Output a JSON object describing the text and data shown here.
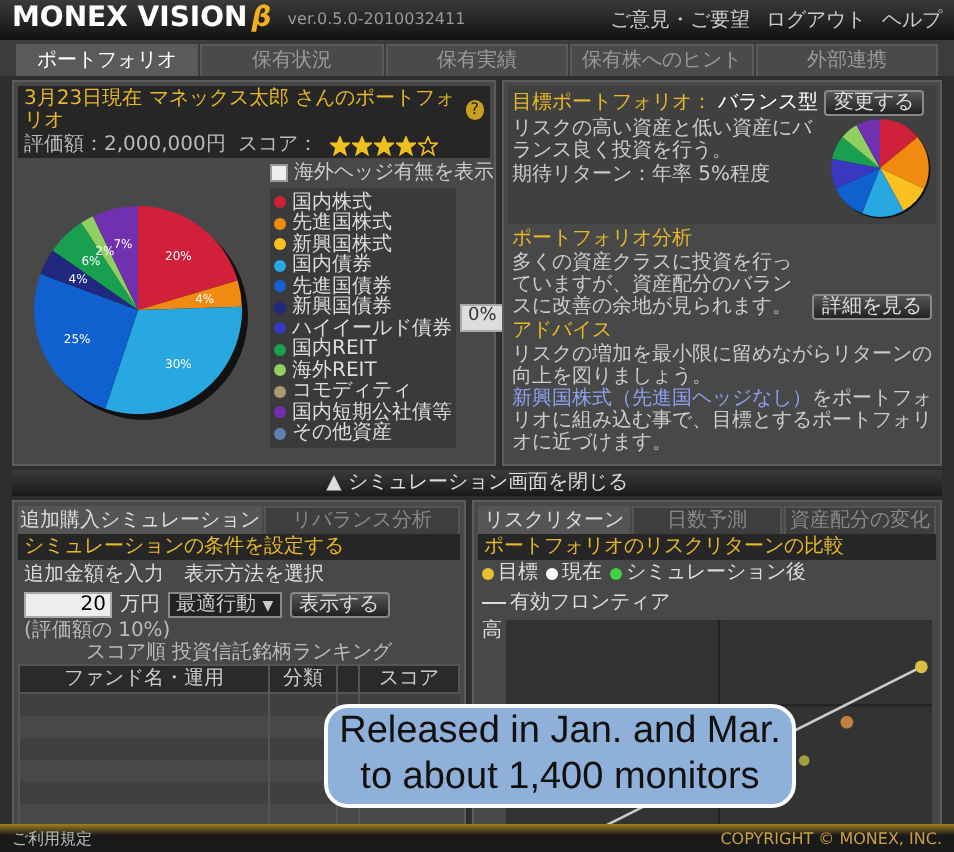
{
  "header": {
    "logo": "MONEX VISION",
    "logo_mark": "β",
    "version": "ver.0.5.0-2010032411",
    "links": [
      "ご意見・ご要望",
      "ログアウト",
      "ヘルプ"
    ]
  },
  "tabs": [
    {
      "label": "ポートフォリオ",
      "selected": true
    },
    {
      "label": "保有状況",
      "selected": false
    },
    {
      "label": "保有実績",
      "selected": false
    },
    {
      "label": "保有株へのヒント",
      "selected": false
    },
    {
      "label": "外部連携",
      "selected": false
    }
  ],
  "portfolio": {
    "title": "3月23日現在 マネックス太郎 さんのポートフォリオ",
    "value_label": "評価額：",
    "value": "2,000,000円",
    "score_label": "スコア：",
    "stars": 4,
    "hedge_checkbox": {
      "label": "海外ヘッジ有無を表示",
      "checked": false
    },
    "help_icon": "?",
    "chart_data": {
      "type": "pie",
      "values": [
        20,
        4,
        30,
        25,
        4,
        6,
        2,
        7
      ],
      "colors": [
        "#d0203a",
        "#f08a10",
        "#28a8e0",
        "#1060d0",
        "#202880",
        "#18a050",
        "#90d060",
        "#7030b0"
      ],
      "value_labels": [
        "20%",
        "4%",
        "30%",
        "25%",
        "4%",
        "6%",
        "2%",
        "7%"
      ]
    },
    "legend": [
      {
        "name": "国内株式",
        "color": "#d0203a"
      },
      {
        "name": "先進国株式",
        "color": "#f08a10"
      },
      {
        "name": "新興国株式",
        "color": "#f8c020"
      },
      {
        "name": "国内債券",
        "color": "#28a8e0"
      },
      {
        "name": "先進国債券",
        "color": "#1060d0"
      },
      {
        "name": "新興国債券",
        "color": "#202880"
      },
      {
        "name": "ハイイールド債券",
        "color": "#3838c0"
      },
      {
        "name": "国内REIT",
        "color": "#18a050"
      },
      {
        "name": "海外REIT",
        "color": "#90d060"
      },
      {
        "name": "コモディティ",
        "color": "#b09870"
      },
      {
        "name": "国内短期公社債等",
        "color": "#7030b0"
      },
      {
        "name": "その他資産",
        "color": "#6080b0"
      }
    ],
    "legend_button": "0%"
  },
  "target": {
    "title": "目標ポートフォリオ：",
    "type": "バランス型",
    "change_button": "変更する",
    "description": "リスクの高い資産と低い資産にバランス良く投資を行う。",
    "expected_return": "期待リターン：年率 5%程度"
  },
  "analysis": {
    "title": "ポートフォリオ分析",
    "text": "多くの資産クラスに投資を行っていますが、資産配分のバランスに改善の余地が見られます。",
    "detail_button": "詳細を見る"
  },
  "advice": {
    "title": "アドバイス",
    "text": "リスクの増加を最小限に留めながらリターンの向上を図りましょう。",
    "link": "新興国株式（先進国ヘッジなし）",
    "text_after": "をポートフォリオに組み込む事で、目標とするポートフォリオに近づけます。"
  },
  "close_bar": "▲ シミュレーション画面を閉じる",
  "simulation": {
    "tabs": [
      {
        "label": "追加購入シミュレーション",
        "selected": true
      },
      {
        "label": "リバランス分析",
        "selected": false
      }
    ],
    "title": "シミュレーションの条件を設定する",
    "steps": [
      "追加金額を入力",
      "表示方法を選択"
    ],
    "amount": "20",
    "unit": "万円",
    "display_select": "最適行動",
    "dropdown_arrow": "▼",
    "show_button": "表示する",
    "note": "(評価額の 10%)",
    "ranking_title": "スコア順 投資信託銘柄ランキング",
    "columns": [
      "ファンド名・運用",
      "分類",
      "スコア"
    ]
  },
  "risk_return": {
    "tabs": [
      {
        "label": "リスクリターン",
        "selected": true
      },
      {
        "label": "日数予測",
        "selected": false
      },
      {
        "label": "資産配分の変化",
        "selected": false
      }
    ],
    "title": "ポートフォリオのリスクリターンの比較",
    "legend": [
      "目標",
      "現在",
      "シミュレーション後",
      "有効フロンティア"
    ],
    "y_label": "高"
  },
  "status": {
    "left": "ご利用規定",
    "right": "COPYRIGHT © MONEX, INC."
  },
  "callout": [
    "Released in Jan. and Mar.",
    "to about 1,400 monitors"
  ]
}
